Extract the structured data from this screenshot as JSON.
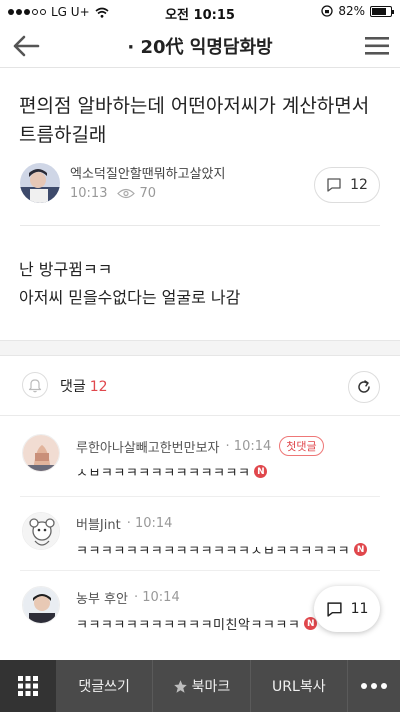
{
  "status": {
    "carrier": "LG U+",
    "time": "오전 10:15",
    "battery": "82%",
    "battery_level": 0.82
  },
  "nav": {
    "title": "· 20代 익명담화방"
  },
  "post": {
    "title": "편의점 알바하는데 어떤아저씨가 계산하면서 트름하길래",
    "author": "엑소덕질안할땐뭐하고살았지",
    "time": "10:13",
    "views": "70",
    "comment_count": "12",
    "body_lines": [
      "난 방구뀜ㅋㅋ",
      "아저씨 믿을수없다는 얼굴로 나감"
    ]
  },
  "comments_header": {
    "label": "댓글",
    "count": "12"
  },
  "comments": [
    {
      "author": "루한아나살빼고한번만보자",
      "time": "10:14",
      "badge": "첫댓글",
      "text": "ㅅㅂㅋㅋㅋㅋㅋㅋㅋㅋㅋㅋㅋㅋ"
    },
    {
      "author": "버블Jint",
      "time": "10:14",
      "text": "ㅋㅋㅋㅋㅋㅋㅋㅋㅋㅋㅋㅋㅋㅋㅅㅂㅋㅋㅋㅋㅋㅋ"
    },
    {
      "author": "농부 후안",
      "time": "10:14",
      "text": "ㅋㅋㅋㅋㅋㅋㅋㅋㅋㅋㅋ미친악ㅋㅋㅋㅋ"
    }
  ],
  "new_badge": "N",
  "floating": {
    "count": "11"
  },
  "toolbar": {
    "comment_write": "댓글쓰기",
    "bookmark": "북마크",
    "url_copy": "URL복사"
  },
  "colors": {
    "accent": "#e0474c",
    "toolbar": "#4a4a4a"
  }
}
